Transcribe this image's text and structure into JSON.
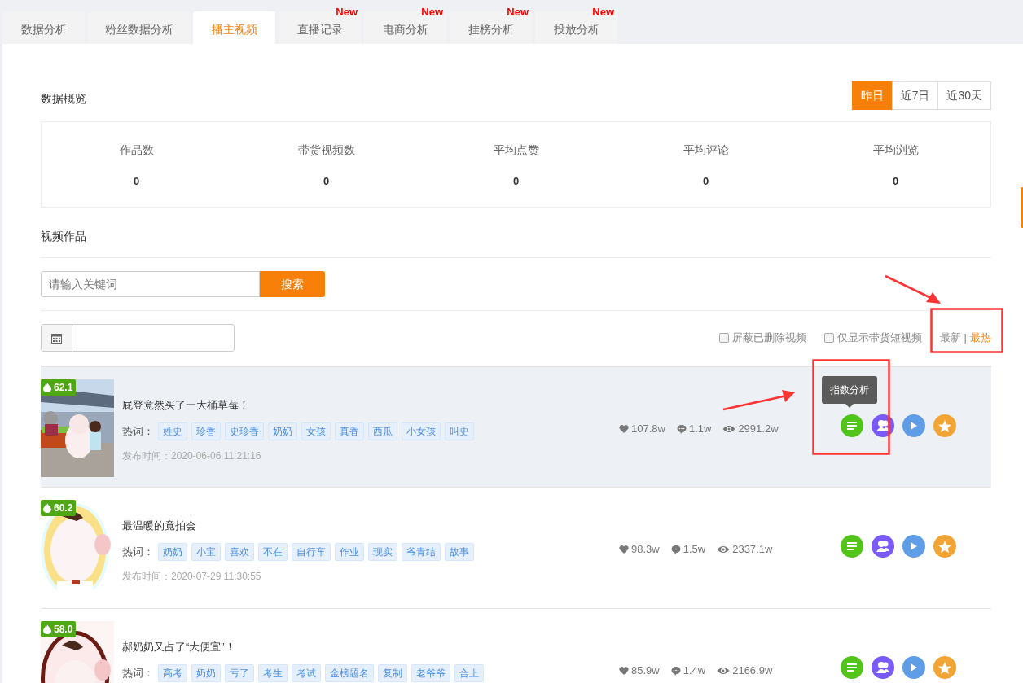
{
  "tabs": [
    {
      "label": "数据分析",
      "selected": false
    },
    {
      "label": "粉丝数据分析",
      "selected": false
    },
    {
      "label": "播主视频",
      "selected": true
    },
    {
      "label": "直播记录",
      "selected": false,
      "badge": "New"
    },
    {
      "label": "电商分析",
      "selected": false,
      "badge": "New"
    },
    {
      "label": "挂榜分析",
      "selected": false,
      "badge": "New"
    },
    {
      "label": "投放分析",
      "selected": false,
      "badge": "New"
    }
  ],
  "overview": {
    "title": "数据概览",
    "ranges": [
      {
        "label": "昨日",
        "selected": true
      },
      {
        "label": "近7日",
        "selected": false
      },
      {
        "label": "近30天",
        "selected": false
      }
    ],
    "stats": [
      {
        "label": "作品数",
        "value": "0"
      },
      {
        "label": "带货视频数",
        "value": "0"
      },
      {
        "label": "平均点赞",
        "value": "0"
      },
      {
        "label": "平均评论",
        "value": "0"
      },
      {
        "label": "平均浏览",
        "value": "0"
      }
    ]
  },
  "videos": {
    "title": "视频作品",
    "search": {
      "placeholder": "请输入关键词",
      "button": "搜索"
    },
    "filters": [
      {
        "label": "屏蔽已删除视频",
        "checked": false
      },
      {
        "label": "仅显示带货短视频",
        "checked": false
      }
    ],
    "sort": [
      {
        "label": "最新",
        "selected": false
      },
      {
        "label": "最热",
        "selected": true
      }
    ],
    "sort_separator": "|",
    "rows": [
      {
        "score": "62.1",
        "title": "屁登竟然买了一大桶草莓！",
        "keywords_label": "热词：",
        "keywords": [
          "姓史",
          "珍香",
          "史珍香",
          "奶奶",
          "女孩",
          "真香",
          "西瓜",
          "小女孩",
          "叫史"
        ],
        "published": "发布时间：2020-06-06 11:21:16",
        "likes": "107.8w",
        "comments": "1.1w",
        "views": "2991.2w",
        "highlighted": true,
        "tooltip": "指数分析"
      },
      {
        "score": "60.2",
        "title": "最温暖的竟拍会",
        "keywords_label": "热词：",
        "keywords": [
          "奶奶",
          "小宝",
          "喜欢",
          "不在",
          "自行车",
          "作业",
          "现实",
          "爷青结",
          "故事"
        ],
        "published": "发布时间：2020-07-29 11:30:55",
        "likes": "98.3w",
        "comments": "1.5w",
        "views": "2337.1w",
        "highlighted": false
      },
      {
        "score": "58.0",
        "title": "郝奶奶又占了“大便宜”！",
        "keywords_label": "热词：",
        "keywords": [
          "高考",
          "奶奶",
          "亏了",
          "考生",
          "考试",
          "金榜题名",
          "复制",
          "老爷爷",
          "合上"
        ],
        "likes": "85.9w",
        "comments": "1.4w",
        "views": "2166.9w",
        "highlighted": false
      }
    ]
  }
}
